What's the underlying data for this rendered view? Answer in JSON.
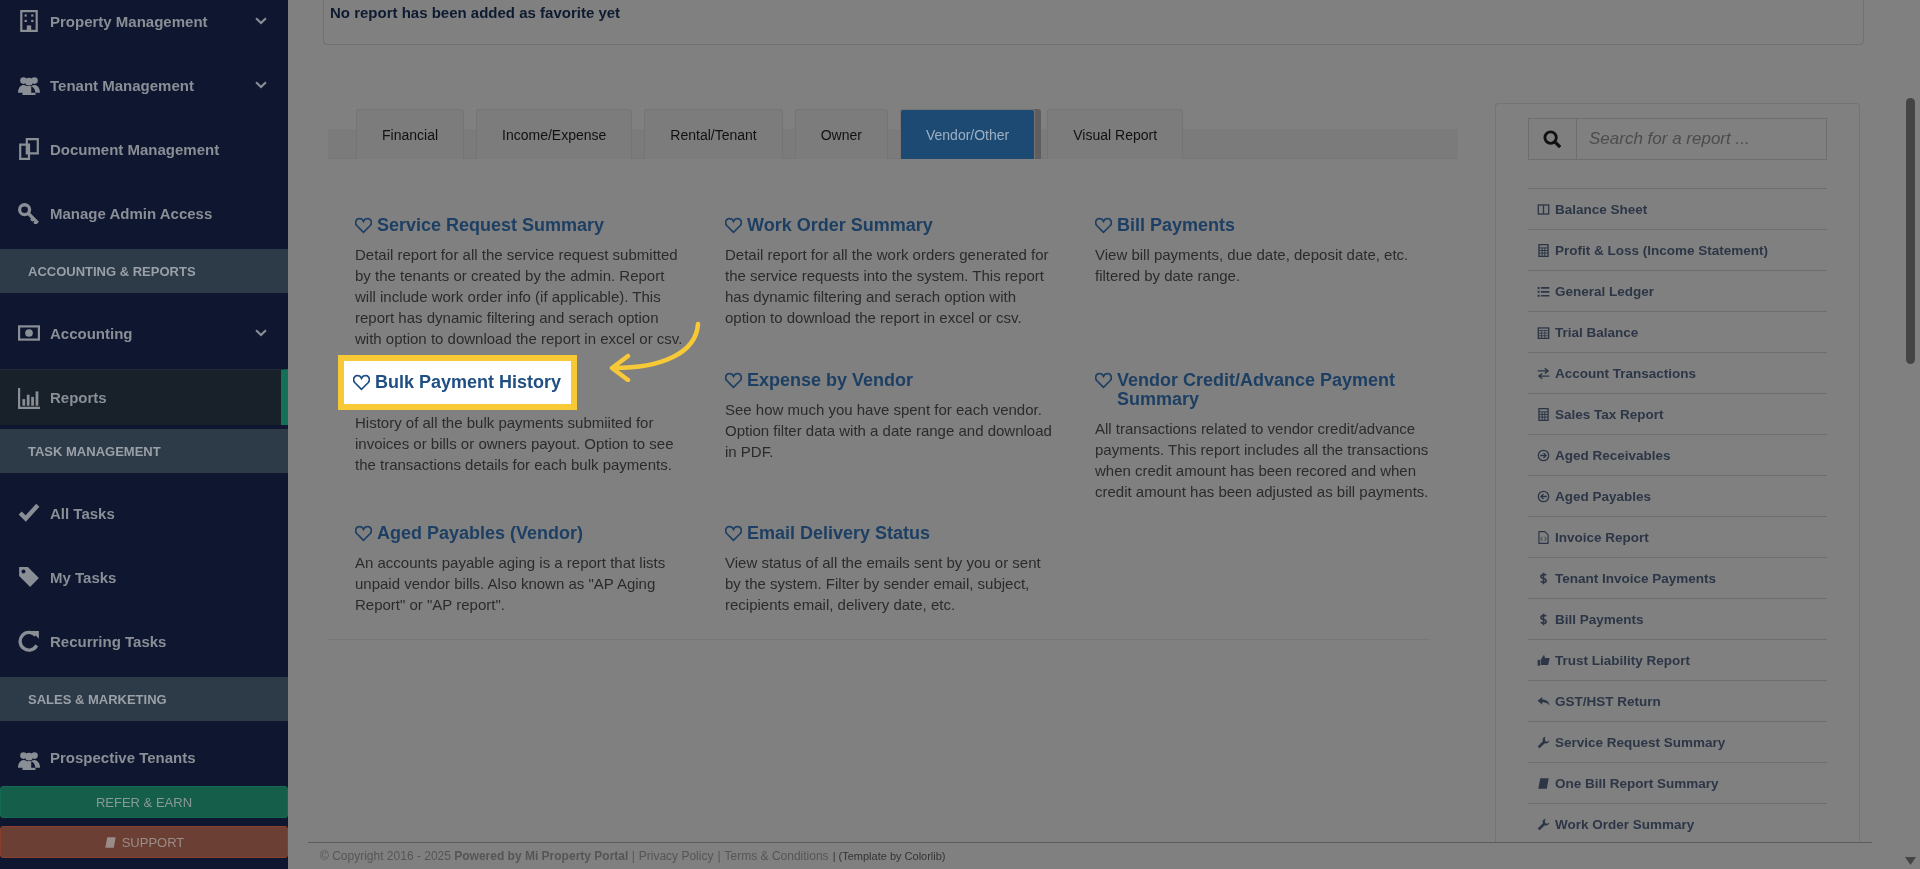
{
  "sidebar": {
    "items": [
      {
        "kind": "item",
        "label": "Property Management",
        "collapsible": true,
        "selected": false
      },
      {
        "kind": "item",
        "label": "Tenant Management",
        "collapsible": true,
        "selected": false
      },
      {
        "kind": "item",
        "label": "Document Management",
        "collapsible": false,
        "selected": false
      },
      {
        "kind": "item",
        "label": "Manage Admin Access",
        "collapsible": false,
        "selected": false
      },
      {
        "kind": "header",
        "label": "ACCOUNTING & REPORTS"
      },
      {
        "kind": "item",
        "label": "Accounting",
        "collapsible": true,
        "selected": false
      },
      {
        "kind": "item",
        "label": "Reports",
        "collapsible": false,
        "selected": true
      },
      {
        "kind": "header",
        "label": "TASK MANAGEMENT"
      },
      {
        "kind": "item",
        "label": "All Tasks",
        "collapsible": false,
        "selected": false
      },
      {
        "kind": "item",
        "label": "My Tasks",
        "collapsible": false,
        "selected": false
      },
      {
        "kind": "item",
        "label": "Recurring Tasks",
        "collapsible": false,
        "selected": false
      },
      {
        "kind": "header",
        "label": "SALES & MARKETING"
      },
      {
        "kind": "item",
        "label": "Prospective Tenants",
        "collapsible": false,
        "selected": false
      }
    ],
    "buttons": [
      {
        "kind": "refer",
        "label": "REFER & EARN"
      },
      {
        "kind": "support",
        "label": "SUPPORT"
      }
    ]
  },
  "favorites": {
    "message": "No report has been added as favorite yet"
  },
  "tabs": [
    {
      "label": "Financial",
      "selected": false
    },
    {
      "label": "Income/Expense",
      "selected": false
    },
    {
      "label": "Rental/Tenant",
      "selected": false
    },
    {
      "label": "Owner",
      "selected": false
    },
    {
      "label": "Vendor/Other",
      "selected": true
    },
    {
      "label": "Visual Report",
      "selected": false
    }
  ],
  "reports": [
    {
      "title": "Service Request Summary",
      "description": "Detail report for all the service request submitted by the tenants or created by the admin. Report will include work order info (if applicable). This report has dynamic filtering and serach option with option to download the report in excel or csv.",
      "favorite": false,
      "highlighted": false
    },
    {
      "title": "Work Order Summary",
      "description": "Detail report for all the work orders generated for the service requests into the system. This report has dynamic filtering and serach option with option to download the report in excel or csv.",
      "favorite": false,
      "highlighted": false
    },
    {
      "title": "Bill Payments",
      "description": "View bill payments, due date, deposit date, etc. filtered by date range.",
      "favorite": false,
      "highlighted": false
    },
    {
      "title": "Bulk Payment History",
      "description": "History of all the bulk payments submiited for invoices or bills or owners payout. Option to see the transactions details for each bulk payments.",
      "favorite": false,
      "highlighted": true
    },
    {
      "title": "Expense by Vendor",
      "description": "See how much you have spent for each vendor. Option filter data with a date range and download in PDF.",
      "favorite": false,
      "highlighted": false
    },
    {
      "title": "Vendor Credit/Advance Payment Summary",
      "description": "All transactions related to vendor credit/advance payments. This report includes all the transactions when credit amount has been recored and when credit amount has been adjusted as bill payments.",
      "favorite": false,
      "highlighted": false
    },
    {
      "title": "Aged Payables (Vendor)",
      "description": "An accounts payable aging is a report that lists unpaid vendor bills. Also known as \"AP Aging Report\" or \"AP report\".",
      "favorite": false,
      "highlighted": false
    },
    {
      "title": "Email Delivery Status",
      "description": "View status of all the emails sent by you or sent by the system. Filter by sender email, subject, recipients email, delivery date, etc.",
      "favorite": false,
      "highlighted": false
    }
  ],
  "search": {
    "placeholder": "Search for a report ..."
  },
  "quick_links": [
    "Balance Sheet",
    "Profit & Loss (Income Statement)",
    "General Ledger",
    "Trial Balance",
    "Account Transactions",
    "Sales Tax Report",
    "Aged Receivables",
    "Aged Payables",
    "Invoice Report",
    "Tenant Invoice Payments",
    "Bill Payments",
    "Trust Liability Report",
    "GST/HST Return",
    "Service Request Summary",
    "One Bill Report Summary",
    "Work Order Summary"
  ],
  "footer": [
    {
      "kind": "text",
      "text": "© Copyright 2016 - 2025 **Powered by Mi Property Portal** |"
    },
    {
      "kind": "link",
      "text": "Privacy Policy"
    },
    {
      "kind": "text",
      "text": "|"
    },
    {
      "kind": "link",
      "text": "Terms & Conditions"
    },
    {
      "kind": "note",
      "text": "| (Template by Colorlib)"
    }
  ]
}
